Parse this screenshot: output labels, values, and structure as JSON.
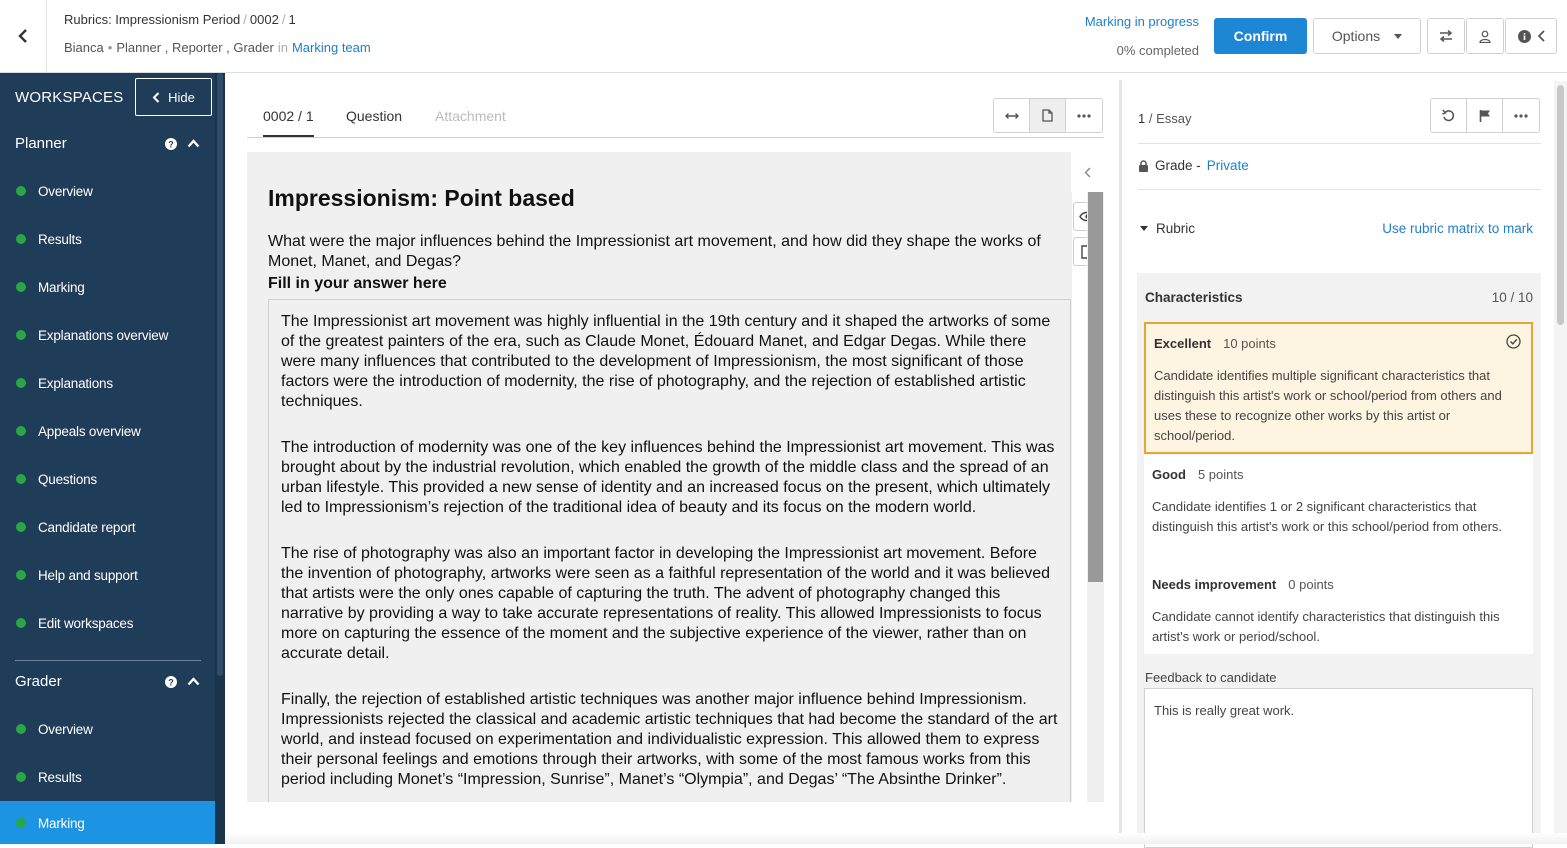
{
  "header": {
    "title_parts": [
      "Rubrics: Impressionism Period",
      "0002",
      "1"
    ],
    "candidate": "Bianca",
    "roles": "Planner , Reporter , Grader",
    "in_label": "in",
    "team": "Marking team",
    "status": "Marking in progress",
    "progress": "0% completed",
    "confirm_label": "Confirm",
    "options_label": "Options"
  },
  "sidebar": {
    "title": "WORKSPACES",
    "hide_label": "Hide",
    "planner": {
      "label": "Planner",
      "items": [
        "Overview",
        "Results",
        "Marking",
        "Explanations overview",
        "Explanations",
        "Appeals overview",
        "Questions",
        "Candidate report",
        "Help and support",
        "Edit workspaces"
      ]
    },
    "grader": {
      "label": "Grader",
      "items": [
        "Overview",
        "Results",
        "Marking"
      ],
      "active": "Marking"
    }
  },
  "tabs": {
    "items": [
      "0002 / 1",
      "Question",
      "Attachment"
    ],
    "active": "0002 / 1",
    "disabled": "Attachment"
  },
  "document": {
    "title": "Impressionism: Point based",
    "question": "What were the major influences behind the Impressionist art movement, and how did they shape the works of Monet, Manet, and Degas?",
    "fill_label": "Fill in your answer here",
    "answer": [
      "The Impressionist art movement was highly influential in the 19th century and it shaped the artworks of some of the greatest painters of the era, such as Claude Monet, Édouard Manet, and Edgar Degas. While there were many influences that contributed to the development of Impressionism, the most significant of those factors were the introduction of modernity, the rise of photography, and the rejection of established artistic techniques.",
      "The introduction of modernity was one of the key influences behind the Impressionist art movement. This was brought about by the industrial revolution, which enabled the growth of the middle class and the spread of an urban lifestyle. This provided a new sense of identity and an increased focus on the present, which ultimately led to Impressionism’s rejection of the traditional idea of beauty and its focus on the modern world.",
      "The rise of photography was also an important factor in developing the Impressionist art movement. Before the invention of photography, artworks were seen as a faithful representation of the world and it was believed that artists were the only ones capable of capturing the truth. The advent of photography changed this narrative by providing a way to take accurate representations of reality. This allowed Impressionists to focus more on capturing the essence of the moment and the subjective experience of the viewer, rather than on accurate detail.",
      "Finally, the rejection of established artistic techniques was another major influence behind Impressionism. Impressionists rejected the classical and academic artistic techniques that had become the standard of the art world, and instead focused on experimentation and individualistic expression. This allowed them to express their personal feelings and emotions through their artworks, with some of the most famous works from this period including Monet’s “Impression, Sunrise”, Manet’s “Olympia”, and Degas’ “The Absinthe Drinker”."
    ]
  },
  "marking": {
    "question_num": "1",
    "question_type": "Essay",
    "grade_label": "Grade -",
    "grade_visibility": "Private",
    "rubric_label": "Rubric",
    "rubric_link": "Use rubric matrix to mark",
    "criterion": {
      "title": "Characteristics",
      "score": "10 / 10",
      "levels": [
        {
          "name": "Excellent",
          "points": "10 points",
          "selected": true,
          "desc": "Candidate identifies multiple significant characteristics that distinguish this artist's work or school/period from others and uses these to recognize other works by this artist or school/period."
        },
        {
          "name": "Good",
          "points": "5 points",
          "selected": false,
          "desc": "Candidate identifies 1 or 2 significant characteristics that distinguish this artist's work or this school/period from others."
        },
        {
          "name": "Needs improvement",
          "points": "0 points",
          "selected": false,
          "desc": "Candidate cannot identify characteristics that distinguish this artist's work or period/school."
        }
      ]
    },
    "feedback_label": "Feedback to candidate",
    "feedback_text": "This is really great work."
  },
  "colors": {
    "sidebar_bg": "#1f3d59",
    "active_nav": "#1d93e4",
    "primary": "#1d87d6",
    "selected_border": "#e6a732",
    "selected_bg": "#fdf4e1",
    "status_dot": "#28a745"
  }
}
